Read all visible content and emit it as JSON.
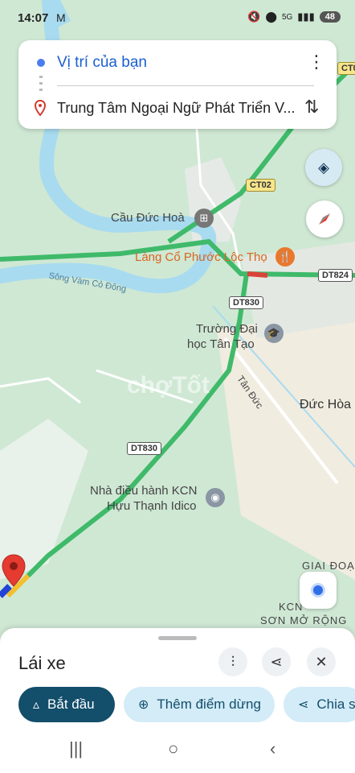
{
  "status_bar": {
    "time": "14:07",
    "mail_icon": "gmail-icon",
    "network": "5G",
    "battery": "48"
  },
  "route": {
    "origin": "Vị trí của bạn",
    "destination": "Trung Tâm Ngoại Ngữ Phát Triển V..."
  },
  "map": {
    "labels": {
      "bridge": "Cầu Đức Hoà",
      "restaurant": "Làng Cổ Phước Lộc Thọ",
      "river": "Sông Vàm Cỏ Đông",
      "university_line1": "Trường Đại",
      "university_line2": "học Tân Tạo",
      "street": "Tân Đức",
      "district": "Đức Hòa",
      "kcn_line1": "Nhà điều hành KCN",
      "kcn_line2": "Hựu Thạnh Idico",
      "giai_doan": "GIAI ĐOẠ",
      "kcn_ext_line1": "KCN",
      "kcn_ext_line2": "SƠN MỞ RỘNG",
      "watermark": "chợTốt"
    },
    "shields": {
      "ct02": "CT02",
      "ct0_edge": "CT0",
      "dt824": "DT824",
      "dt830_upper": "DT830",
      "dt830_lower": "DT830"
    },
    "colors": {
      "route": "#3fba6a",
      "route_yellow": "#f2c02c",
      "route_red": "#d9443a",
      "water": "#a8dbef",
      "land": "#cfe8d4"
    }
  },
  "sheet": {
    "mode_title": "Lái xe",
    "start_label": "Bắt đầu",
    "add_stop_label": "Thêm điểm dừng",
    "share_label": "Chia s"
  }
}
